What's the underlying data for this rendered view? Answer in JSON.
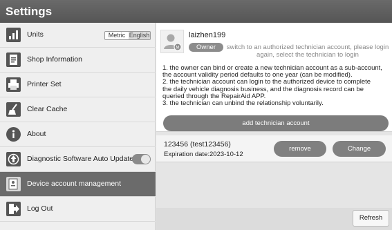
{
  "window": {
    "title": "Settings"
  },
  "sidebar": {
    "items": [
      {
        "label": "Units",
        "icon": "bar-chart-icon"
      },
      {
        "label": "Shop Information",
        "icon": "document-icon"
      },
      {
        "label": "Printer Set",
        "icon": "printer-icon"
      },
      {
        "label": "Clear Cache",
        "icon": "broom-icon"
      },
      {
        "label": "About",
        "icon": "info-icon"
      },
      {
        "label": "Diagnostic Software Auto Update",
        "icon": "upload-icon"
      },
      {
        "label": "Device account management",
        "icon": "account-icon"
      },
      {
        "label": "Log Out",
        "icon": "logout-icon"
      }
    ],
    "units": {
      "metric_label": "Metric",
      "english_label": "English",
      "selected": "Metric"
    },
    "auto_update_enabled": true,
    "active_item": "Device account management"
  },
  "account": {
    "username": "laizhen199",
    "role_badge": "Owner",
    "role_hint": "switch to an authorized technician account, please login again, select the technician to login",
    "description_lines": [
      "1. the owner can bind or create a new technician account as a sub-account,",
      "the account validity period defaults to one year (can be modified).",
      "2. the technician account can login to the authorized device to complete",
      "the daily vehicle diagnosis business, and the diagnosis record can be",
      "queried through the RepairAid APP.",
      "3. the technician can unbind the relationship voluntarily."
    ],
    "add_button_label": "add technician account"
  },
  "technicians": [
    {
      "name": "123456 (test123456)",
      "expiration": "Expiration date:2023-10-12",
      "remove_label": "remove",
      "change_label": "Change"
    }
  ],
  "footer": {
    "refresh_label": "Refresh"
  },
  "colors": {
    "titlebar": "#5f5f5f",
    "active_item": "#6b6b6b",
    "pill_button": "#7c7c7c"
  }
}
